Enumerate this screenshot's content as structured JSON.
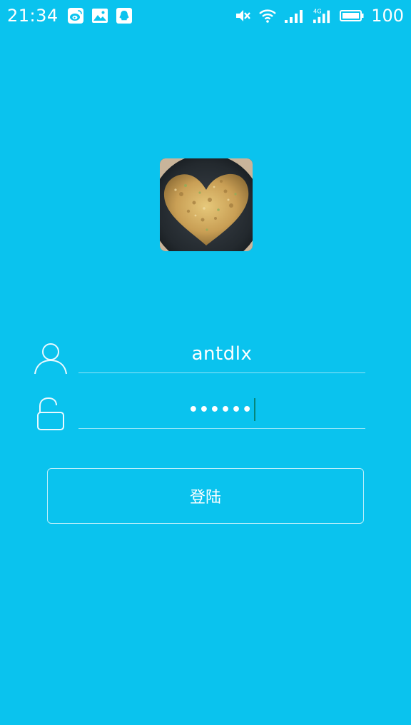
{
  "status_bar": {
    "time": "21:34",
    "left_icons": [
      "weibo-icon",
      "image-icon",
      "qq-icon"
    ],
    "right_icons": [
      "mute-icon",
      "wifi-icon",
      "signal-icon",
      "4g-signal-icon",
      "battery-icon"
    ],
    "battery": "100"
  },
  "avatar": {
    "icon": "avatar-image"
  },
  "form": {
    "username_value": "antdlx",
    "username_icon": "user-icon",
    "password_value": "••••••",
    "password_icon": "unlock-icon"
  },
  "login_button": {
    "label": "登陆"
  },
  "colors": {
    "background": "#0ac3ee",
    "text": "#ffffff",
    "caret": "#06867a"
  }
}
